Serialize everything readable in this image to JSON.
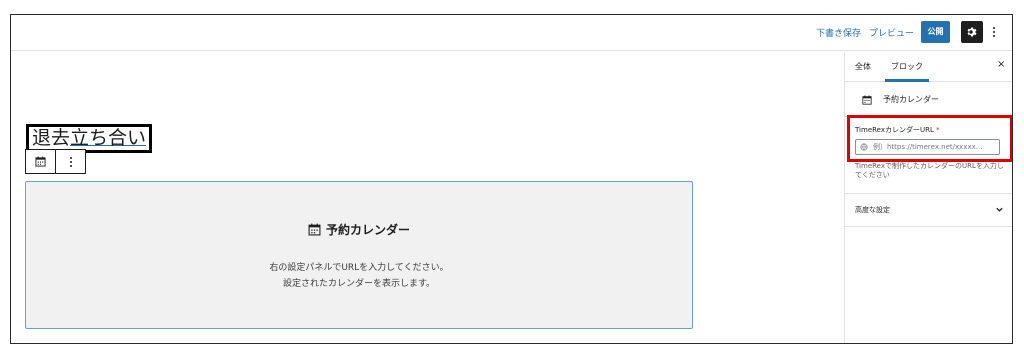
{
  "toolbar": {
    "save_draft": "下書き保存",
    "preview": "プレビュー",
    "publish": "公開",
    "settings_icon": "gear-icon",
    "more_icon": "vertical-dots-icon"
  },
  "editor": {
    "title_part1": "退去",
    "title_part2": "立ち合い",
    "block_toolbar_icon": "calendar-icon",
    "placeholder": {
      "icon": "calendar-icon",
      "title": "予約カレンダー",
      "line1": "右の設定パネルでURLを入力してください。",
      "line2": "設定されたカレンダーを表示します。"
    }
  },
  "sidebar": {
    "tabs": {
      "all": "全体",
      "block": "ブロック"
    },
    "close_label": "×",
    "block_card": {
      "icon": "calendar-icon",
      "name": "予約カレンダー"
    },
    "url_field": {
      "label": "TimeRexカレンダーURL",
      "required_mark": "*",
      "placeholder": "例）https://timerex.net/xxxxx...",
      "help": "TimeRexで制作したカレンダーのURLを入力してください"
    },
    "advanced": {
      "label": "高度な設定",
      "icon": "chevron-down-icon"
    }
  },
  "colors": {
    "accent": "#2271b1",
    "highlight": "#e00000",
    "required": "#cc1818"
  }
}
